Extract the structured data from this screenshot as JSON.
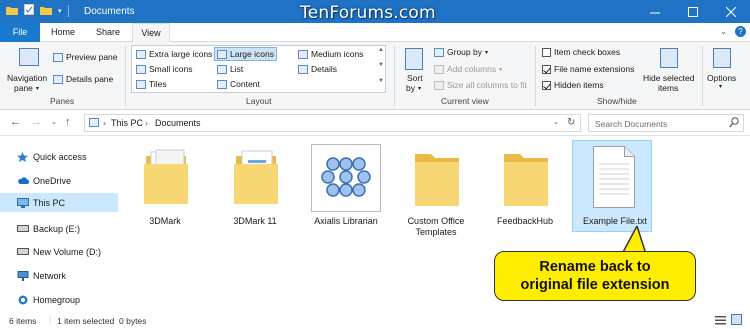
{
  "window": {
    "title": "Documents",
    "watermark": "TenForums.com",
    "min_icon": "minimize-icon",
    "max_icon": "maximize-icon",
    "close_icon": "close-icon"
  },
  "tabs": [
    {
      "label": "File"
    },
    {
      "label": "Home"
    },
    {
      "label": "Share"
    },
    {
      "label": "View"
    }
  ],
  "ribbon": {
    "panes": {
      "group_label": "Panes",
      "navigation_pane": "Navigation",
      "navigation_pane_line2": "pane",
      "preview_pane": "Preview pane",
      "details_pane": "Details pane"
    },
    "layout": {
      "group_label": "Layout",
      "options": [
        "Extra large icons",
        "Large icons",
        "Medium icons",
        "Small icons",
        "List",
        "Details",
        "Tiles",
        "Content"
      ],
      "selected": "Large icons"
    },
    "current_view": {
      "group_label": "Current view",
      "sort_by": "Sort",
      "sort_by_line2": "by",
      "group_by": "Group by",
      "add_columns": "Add columns",
      "size_columns": "Size all columns to fit"
    },
    "show_hide": {
      "group_label": "Show/hide",
      "item_check_boxes": "Item check boxes",
      "item_check_boxes_checked": false,
      "file_name_extensions": "File name extensions",
      "file_name_extensions_checked": true,
      "hidden_items": "Hidden items",
      "hidden_items_checked": true,
      "hide_selected": "Hide selected",
      "hide_selected_line2": "items"
    },
    "options": "Options"
  },
  "address": {
    "crumbs": [
      "This PC",
      "Documents"
    ],
    "search_placeholder": "Search Documents"
  },
  "nav_pane": {
    "items": [
      {
        "label": "Quick access",
        "icon": "star-icon"
      },
      {
        "label": "OneDrive",
        "icon": "cloud-icon"
      },
      {
        "label": "This PC",
        "icon": "computer-icon",
        "active": true
      },
      {
        "label": "Backup (E:)",
        "icon": "drive-icon"
      },
      {
        "label": "New Volume (D:)",
        "icon": "drive-icon"
      },
      {
        "label": "Network",
        "icon": "network-icon"
      },
      {
        "label": "Homegroup",
        "icon": "homegroup-icon"
      }
    ]
  },
  "files": [
    {
      "name": "3DMark",
      "type": "folder"
    },
    {
      "name": "3DMark 11",
      "type": "folder"
    },
    {
      "name": "Axialis Librarian",
      "type": "app-folder"
    },
    {
      "name": "Custom Office Templates",
      "type": "folder"
    },
    {
      "name": "FeedbackHub",
      "type": "folder"
    },
    {
      "name": "Example File.txt",
      "type": "file",
      "selected": true
    }
  ],
  "callout": {
    "line1": "Rename back to",
    "line2": "original file extension",
    "color": "#ffee00"
  },
  "status": {
    "item_count": "6 items",
    "selected": "1 item selected",
    "size": "0 bytes"
  },
  "colors": {
    "titlebar": "#1f72c4",
    "file_tab": "#1979ca",
    "selection": "#cce8ff",
    "folder": "#f7d774"
  }
}
